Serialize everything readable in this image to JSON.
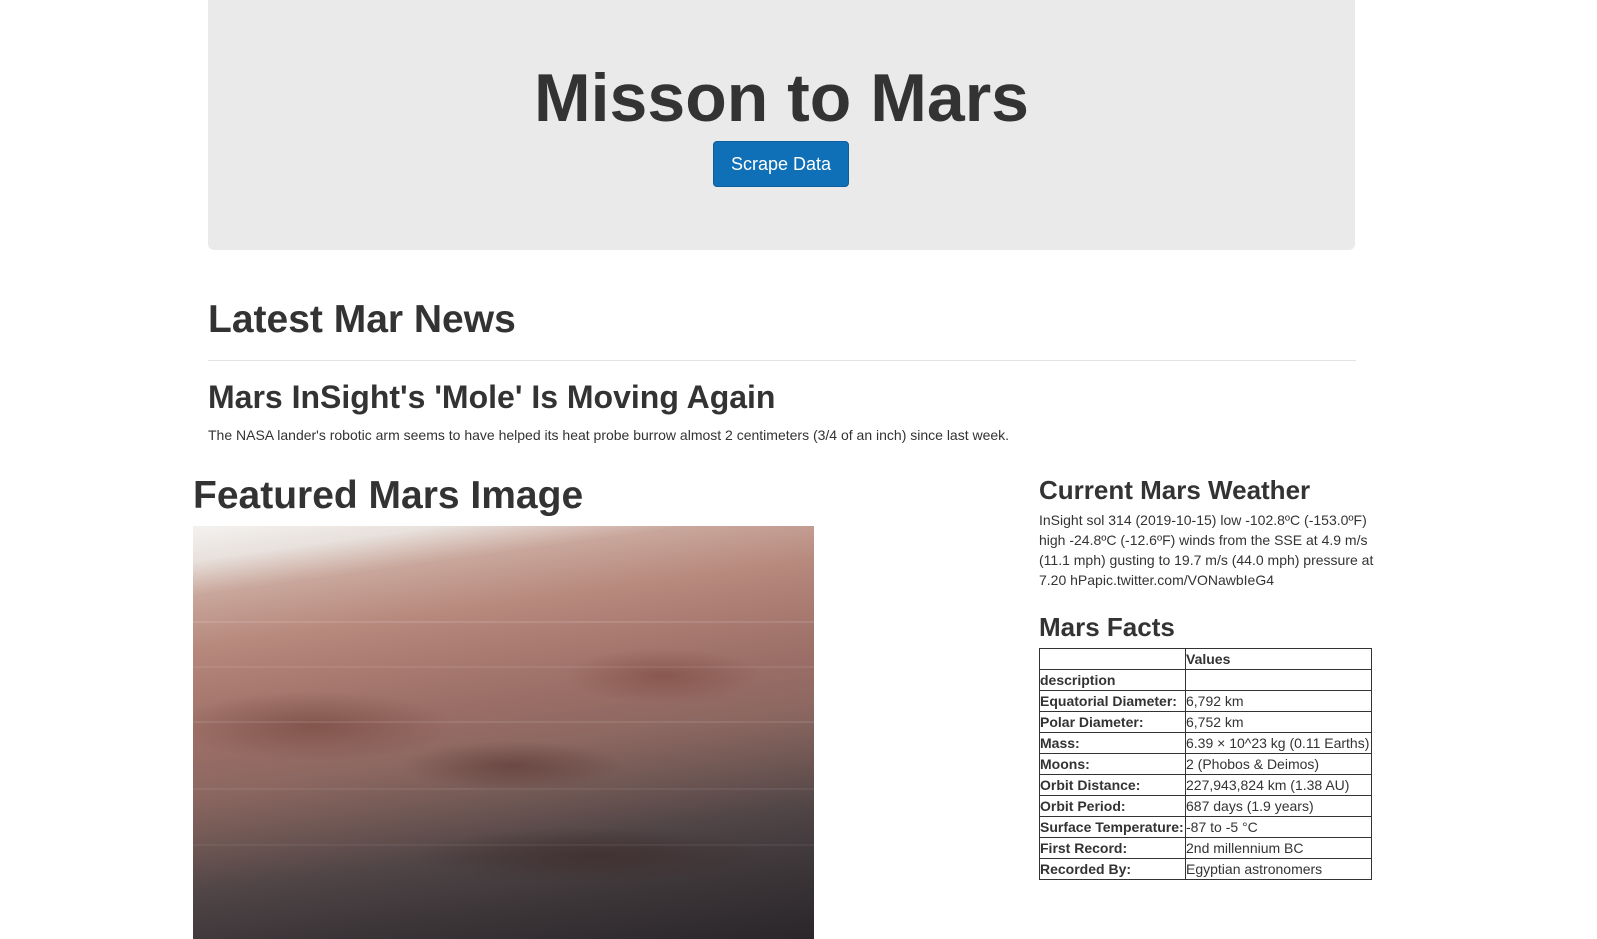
{
  "header": {
    "title": "Misson to Mars",
    "scrape_button": "Scrape Data"
  },
  "news": {
    "section_title": "Latest Mar News",
    "headline": "Mars InSight's 'Mole' Is Moving Again",
    "teaser": "The NASA lander's robotic arm seems to have helped its heat probe burrow almost 2 centimeters (3/4 of an inch) since last week."
  },
  "featured": {
    "section_title": "Featured Mars Image",
    "image": "mars-landscape"
  },
  "weather": {
    "section_title": "Current Mars Weather",
    "text": "InSight sol 314 (2019-10-15) low -102.8ºC (-153.0ºF) high -24.8ºC (-12.6ºF) winds from the SSE at 4.9 m/s (11.1 mph) gusting to 19.7 m/s (44.0 mph) pressure at 7.20 hPapic.twitter.com/VONawbIeG4"
  },
  "facts": {
    "section_title": "Mars Facts",
    "header_value": "Values",
    "index_label": "description",
    "rows": [
      {
        "key": "Equatorial Diameter:",
        "value": "6,792 km"
      },
      {
        "key": "Polar Diameter:",
        "value": "6,752 km"
      },
      {
        "key": "Mass:",
        "value": "6.39 × 10^23 kg (0.11 Earths)"
      },
      {
        "key": "Moons:",
        "value": "2 (Phobos & Deimos)"
      },
      {
        "key": "Orbit Distance:",
        "value": "227,943,824 km (1.38 AU)"
      },
      {
        "key": "Orbit Period:",
        "value": "687 days (1.9 years)"
      },
      {
        "key": "Surface Temperature:",
        "value": "-87 to -5 °C"
      },
      {
        "key": "First Record:",
        "value": "2nd millennium BC"
      },
      {
        "key": "Recorded By:",
        "value": "Egyptian astronomers"
      }
    ]
  }
}
